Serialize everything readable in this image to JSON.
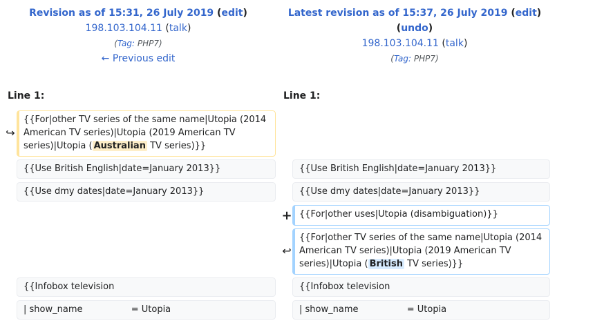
{
  "left": {
    "title_prefix": "Revision as of 15:31, 26 July 2019",
    "edit_link": "edit",
    "user_link": "198.103.104.11",
    "talk_link": "talk",
    "tag_label": "Tag:",
    "tag_value": "PHP7",
    "prev_edit_link": "← Previous edit",
    "line_label": "Line 1:"
  },
  "right": {
    "title_prefix": "Latest revision as of 15:37, 26 July 2019",
    "edit_link": "edit",
    "undo_link": "undo",
    "user_link": "198.103.104.11",
    "talk_link": "talk",
    "tag_label": "Tag:",
    "tag_value": "PHP7",
    "line_label": "Line 1:"
  },
  "diff": {
    "moved_left": {
      "before": "{{For|other TV series of the same name|Utopia (2014 American TV series)|Utopia (2019 American TV series)|Utopia (",
      "changed": "Australian",
      "after": " TV series)}}"
    },
    "ctx_1": "{{Use British English|date=January 2013}}",
    "ctx_2": "{{Use dmy dates|date=January 2013}}",
    "added_line": "{{For|other uses|Utopia (disambiguation)}}",
    "moved_right": {
      "before": "{{For|other TV series of the same name|Utopia (2014 American TV series)|Utopia (2019 American TV series)|Utopia (",
      "changed": "British",
      "after": " TV series)}}"
    },
    "ctx_3": "{{Infobox television",
    "ctx_4": "| show_name                 = Utopia",
    "marker_moved_out": "↪",
    "marker_added": "+",
    "marker_moved_in": "↩"
  }
}
